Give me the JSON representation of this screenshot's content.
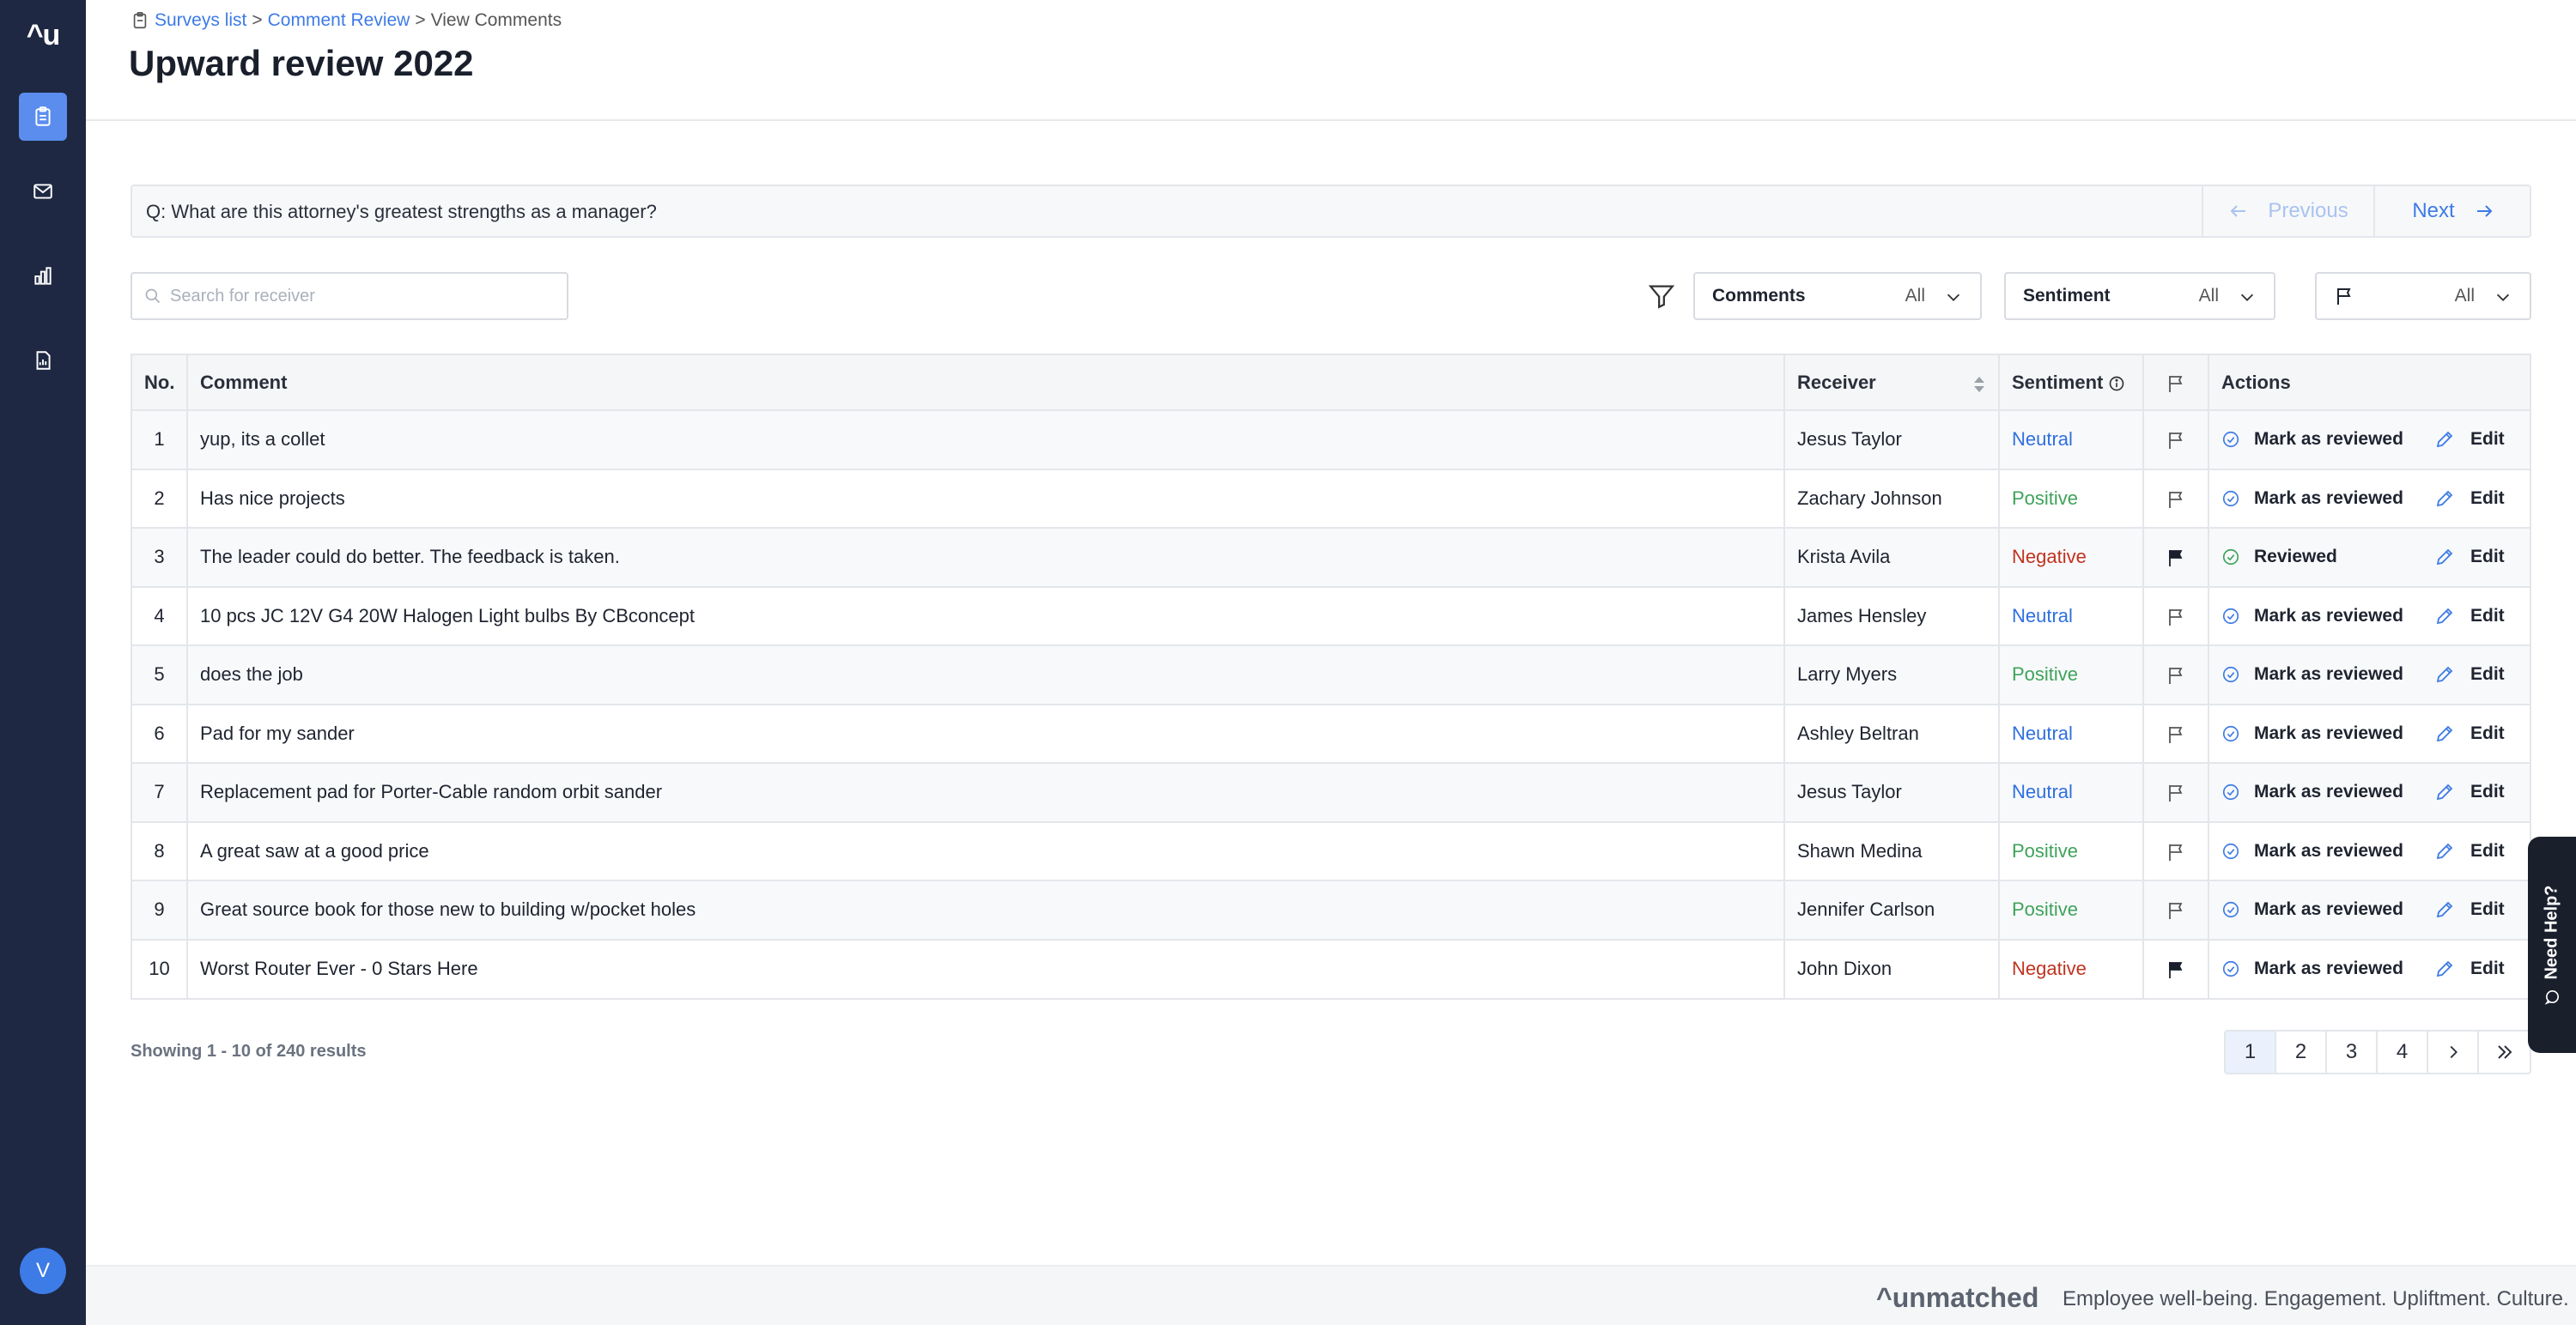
{
  "app": {
    "logo_text": "^u",
    "avatar_initial": "V"
  },
  "sidebar": {
    "items": [
      {
        "name": "surveys",
        "icon": "clipboard-icon",
        "active": true
      },
      {
        "name": "messages",
        "icon": "mail-icon",
        "active": false
      },
      {
        "name": "analytics",
        "icon": "bar-chart-icon",
        "active": false
      },
      {
        "name": "reports",
        "icon": "report-icon",
        "active": false
      }
    ]
  },
  "breadcrumb": {
    "item1": "Surveys list",
    "sep1": ">",
    "item2": "Comment Review",
    "sep2": ">",
    "current": "View Comments"
  },
  "page_title": "Upward review 2022",
  "question": {
    "text": "Q: What are this attorney's greatest strengths as a manager?",
    "prev_label": "Previous",
    "next_label": "Next"
  },
  "filters": {
    "search_placeholder": "Search for receiver",
    "comments": {
      "label": "Comments",
      "value": "All"
    },
    "sentiment": {
      "label": "Sentiment",
      "value": "All"
    },
    "flag": {
      "value": "All"
    }
  },
  "table": {
    "headers": {
      "no": "No.",
      "comment": "Comment",
      "receiver": "Receiver",
      "sentiment": "Sentiment",
      "actions": "Actions"
    },
    "edit_label": "Edit",
    "rows": [
      {
        "no": "1",
        "comment": "yup, its a collet",
        "receiver": "Jesus Taylor",
        "sentiment": "Neutral",
        "flagged": false,
        "action": "Mark as reviewed"
      },
      {
        "no": "2",
        "comment": "Has nice projects",
        "receiver": "Zachary Johnson",
        "sentiment": "Positive",
        "flagged": false,
        "action": "Mark as reviewed"
      },
      {
        "no": "3",
        "comment": "The leader could do better. The feedback is taken.",
        "receiver": "Krista Avila",
        "sentiment": "Negative",
        "flagged": true,
        "action": "Reviewed"
      },
      {
        "no": "4",
        "comment": "10 pcs JC 12V G4 20W Halogen Light bulbs By CBconcept",
        "receiver": "James Hensley",
        "sentiment": "Neutral",
        "flagged": false,
        "action": "Mark as reviewed"
      },
      {
        "no": "5",
        "comment": "does the job",
        "receiver": "Larry Myers",
        "sentiment": "Positive",
        "flagged": false,
        "action": "Mark as reviewed"
      },
      {
        "no": "6",
        "comment": "Pad for my sander",
        "receiver": "Ashley Beltran",
        "sentiment": "Neutral",
        "flagged": false,
        "action": "Mark as reviewed"
      },
      {
        "no": "7",
        "comment": "Replacement pad for Porter-Cable random orbit sander",
        "receiver": "Jesus Taylor",
        "sentiment": "Neutral",
        "flagged": false,
        "action": "Mark as reviewed"
      },
      {
        "no": "8",
        "comment": "A great saw at a good price",
        "receiver": "Shawn Medina",
        "sentiment": "Positive",
        "flagged": false,
        "action": "Mark as reviewed"
      },
      {
        "no": "9",
        "comment": "Great source book for those new to building w/pocket holes",
        "receiver": "Jennifer Carlson",
        "sentiment": "Positive",
        "flagged": false,
        "action": "Mark as reviewed"
      },
      {
        "no": "10",
        "comment": "Worst Router Ever - 0 Stars Here",
        "receiver": "John Dixon",
        "sentiment": "Negative",
        "flagged": true,
        "action": "Mark as reviewed"
      }
    ]
  },
  "results_text": "Showing 1 - 10 of 240 results",
  "pagination": {
    "pages": [
      "1",
      "2",
      "3",
      "4"
    ],
    "current": "1"
  },
  "help_tab": "Need Help?",
  "footer": {
    "brand": "^unmatched",
    "tagline": "Employee well-being. Engagement. Upliftment. Culture."
  },
  "colors": {
    "sidebar": "#1e2842",
    "accent": "#3d7be6",
    "positive": "#3ea35a",
    "negative": "#c0331f",
    "neutral": "#2f6fe0"
  }
}
